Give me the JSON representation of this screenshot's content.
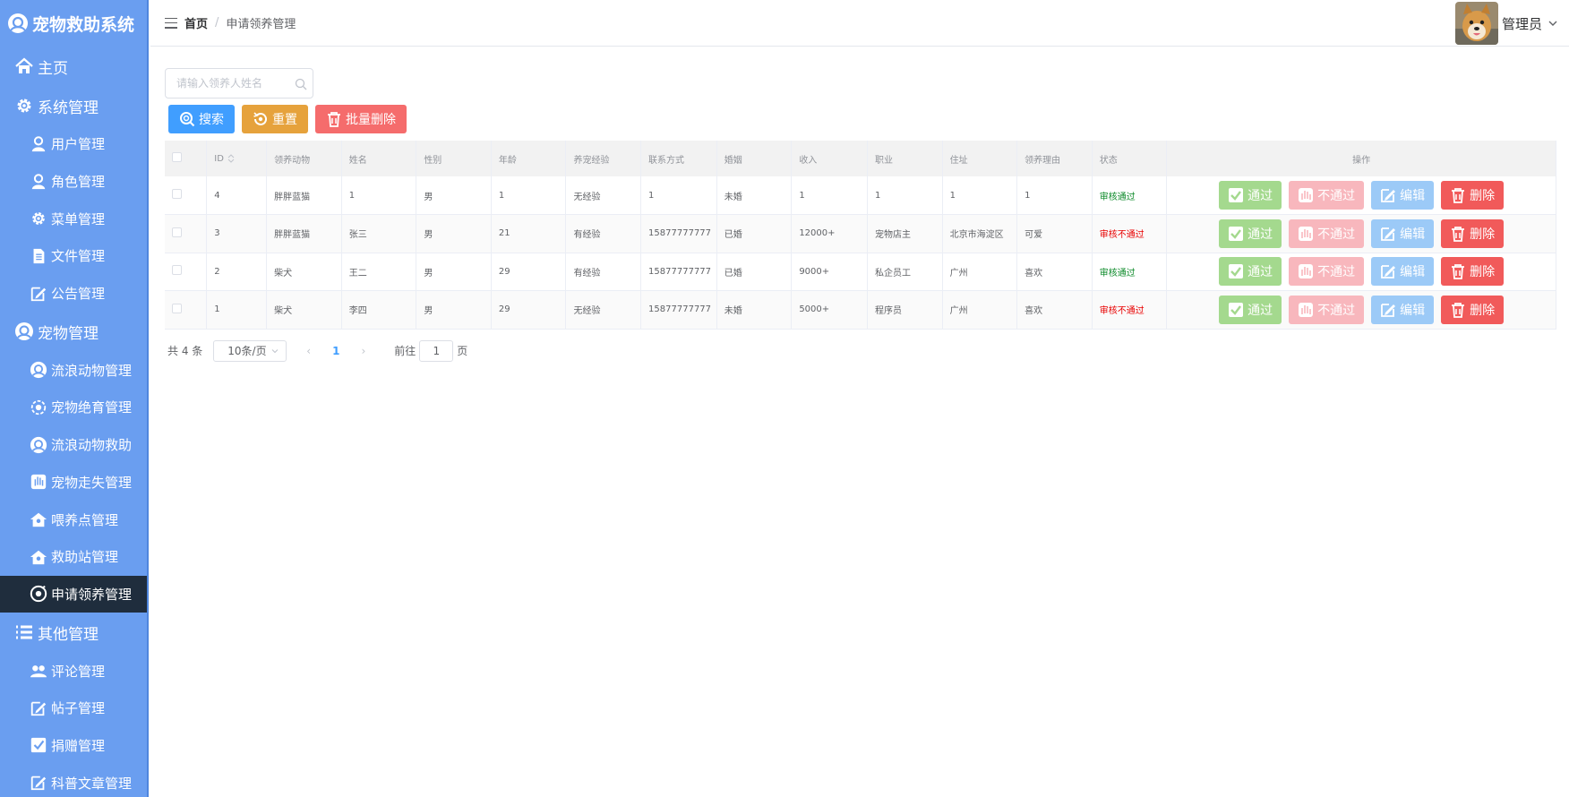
{
  "brand": {
    "title": "宠物救助系统"
  },
  "menu": [
    {
      "label": "主页",
      "level": "top",
      "icon": "home-icon"
    },
    {
      "label": "系统管理",
      "level": "top",
      "icon": "gear-icon"
    },
    {
      "label": "用户管理",
      "level": "sub",
      "icon": "user-icon"
    },
    {
      "label": "角色管理",
      "level": "sub",
      "icon": "user-icon"
    },
    {
      "label": "菜单管理",
      "level": "sub",
      "icon": "gear-icon"
    },
    {
      "label": "文件管理",
      "level": "sub",
      "icon": "document-icon"
    },
    {
      "label": "公告管理",
      "level": "sub",
      "icon": "edit-icon"
    },
    {
      "label": "宠物管理",
      "level": "top",
      "icon": "pet-icon"
    },
    {
      "label": "流浪动物管理",
      "level": "sub",
      "icon": "pet-icon"
    },
    {
      "label": "宠物绝育管理",
      "level": "sub",
      "icon": "target-icon"
    },
    {
      "label": "流浪动物救助",
      "level": "sub",
      "icon": "pet-icon"
    },
    {
      "label": "宠物走失管理",
      "level": "sub",
      "icon": "hand-icon"
    },
    {
      "label": "喂养点管理",
      "level": "sub",
      "icon": "house-icon"
    },
    {
      "label": "救助站管理",
      "level": "sub",
      "icon": "house-icon"
    },
    {
      "label": "申请领养管理",
      "level": "sub",
      "icon": "clip-icon",
      "active": true
    },
    {
      "label": "其他管理",
      "level": "top",
      "icon": "list-icon"
    },
    {
      "label": "评论管理",
      "level": "sub",
      "icon": "people-icon"
    },
    {
      "label": "帖子管理",
      "level": "sub",
      "icon": "edit-icon"
    },
    {
      "label": "捐赠管理",
      "level": "sub",
      "icon": "check-square-icon"
    },
    {
      "label": "科普文章管理",
      "level": "sub",
      "icon": "edit-icon"
    }
  ],
  "breadcrumb": {
    "home": "首页",
    "separator": "/",
    "current": "申请领养管理"
  },
  "user": {
    "name": "管理员"
  },
  "search": {
    "placeholder": "请输入领养人姓名",
    "value": ""
  },
  "toolbar": {
    "search_label": "搜索",
    "reset_label": "重置",
    "batch_delete_label": "批量删除"
  },
  "table": {
    "columns": [
      "ID",
      "领养动物",
      "姓名",
      "性别",
      "年龄",
      "养宠经验",
      "联系方式",
      "婚姻",
      "收入",
      "职业",
      "住址",
      "领养理由",
      "状态",
      "操作"
    ],
    "rows": [
      {
        "id": "4",
        "animal": "胖胖蓝猫",
        "name": "1",
        "gender": "男",
        "age": "1",
        "experience": "无经验",
        "contact": "1",
        "marriage": "未婚",
        "income": "1",
        "job": "1",
        "address": "1",
        "reason": "1",
        "status": "审核通过",
        "status_type": "pass"
      },
      {
        "id": "3",
        "animal": "胖胖蓝猫",
        "name": "张三",
        "gender": "男",
        "age": "21",
        "experience": "有经验",
        "contact": "15877777777",
        "marriage": "已婚",
        "income": "12000+",
        "job": "宠物店主",
        "address": "北京市海淀区",
        "reason": "可爱",
        "status": "审核不通过",
        "status_type": "fail"
      },
      {
        "id": "2",
        "animal": "柴犬",
        "name": "王二",
        "gender": "男",
        "age": "29",
        "experience": "有经验",
        "contact": "15877777777",
        "marriage": "已婚",
        "income": "9000+",
        "job": "私企员工",
        "address": "广州",
        "reason": "喜欢",
        "status": "审核通过",
        "status_type": "pass"
      },
      {
        "id": "1",
        "animal": "柴犬",
        "name": "李四",
        "gender": "男",
        "age": "29",
        "experience": "无经验",
        "contact": "15877777777",
        "marriage": "未婚",
        "income": "5000+",
        "job": "程序员",
        "address": "广州",
        "reason": "喜欢",
        "status": "审核不通过",
        "status_type": "fail"
      }
    ],
    "actions": {
      "pass": "通过",
      "reject": "不通过",
      "edit": "编辑",
      "delete": "删除"
    }
  },
  "pagination": {
    "total_text": "共 4 条",
    "page_size": "10条/页",
    "prev": "‹",
    "current_page": "1",
    "next": "›",
    "goto_label": "前往",
    "goto_value": "1",
    "goto_unit": "页"
  },
  "colors": {
    "sidebar": "#6a9ef0",
    "sidebar_active": "#1f2d3d",
    "primary": "#409eff",
    "warning": "#e6a23c",
    "danger": "#f56c6c",
    "pass_green": "#0c8a29",
    "fail_red": "#e80000"
  }
}
